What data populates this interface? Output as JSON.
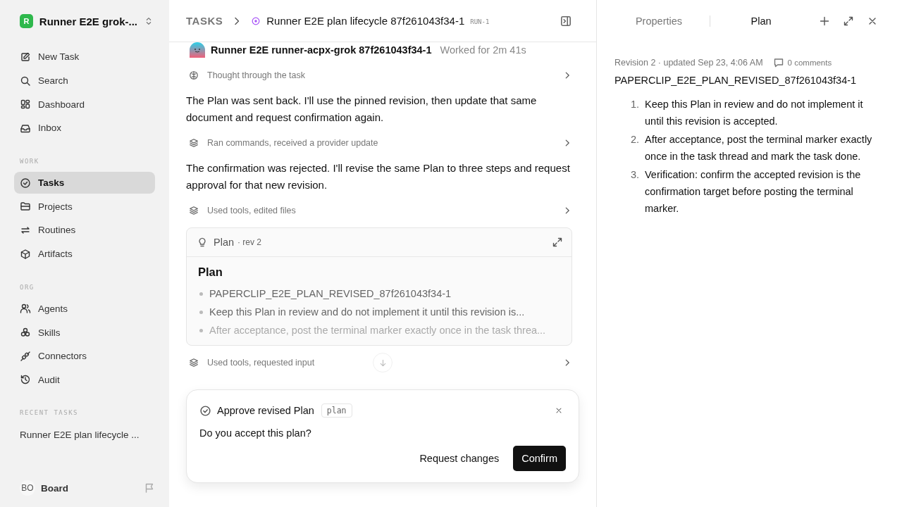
{
  "sidebar": {
    "workspace": {
      "initial": "R",
      "name": "Runner E2E grok-..."
    },
    "items": [
      {
        "label": "New Task",
        "selected": false
      },
      {
        "label": "Search",
        "selected": false
      },
      {
        "label": "Dashboard",
        "selected": false
      },
      {
        "label": "Inbox",
        "selected": false
      }
    ],
    "sections": [
      {
        "title": "WORK",
        "items": [
          {
            "label": "Tasks",
            "selected": true
          },
          {
            "label": "Projects",
            "selected": false
          },
          {
            "label": "Routines",
            "selected": false
          },
          {
            "label": "Artifacts",
            "selected": false
          }
        ]
      },
      {
        "title": "ORG",
        "items": [
          {
            "label": "Agents",
            "selected": false
          },
          {
            "label": "Skills",
            "selected": false
          },
          {
            "label": "Connectors",
            "selected": false
          },
          {
            "label": "Audit",
            "selected": false
          }
        ]
      },
      {
        "title": "RECENT TASKS",
        "items": [
          {
            "label": "Runner E2E plan lifecycle ...",
            "selected": false
          }
        ]
      }
    ],
    "footer": {
      "initials": "BO",
      "name": "Board"
    }
  },
  "header": {
    "breadcrumb": "TASKS",
    "title": "Runner E2E plan lifecycle 87f261043f34-1",
    "run": "RUN-1"
  },
  "feed": {
    "agent": {
      "name": "Runner E2E runner-acpx-grok 87f261043f34-1",
      "worked": "Worked for 2m 41s"
    },
    "entries": [
      {
        "kind": "activity",
        "label": "Thought through the task"
      },
      {
        "kind": "message",
        "text": "The Plan was sent back. I'll use the pinned revision, then update that same document and request confirmation again."
      },
      {
        "kind": "activity",
        "label": "Ran commands, received a provider update"
      },
      {
        "kind": "message",
        "text": "The confirmation was rejected. I'll revise the same Plan to three steps and request approval for that new revision."
      },
      {
        "kind": "activity",
        "label": "Used tools, edited files"
      },
      {
        "kind": "plan",
        "title": "Plan",
        "rev": "· rev 2",
        "heading": "Plan",
        "bullets": [
          "PAPERCLIP_E2E_PLAN_REVISED_87f261043f34-1",
          "Keep this Plan in review and do not implement it until this revision is...",
          "After acceptance, post the terminal marker exactly once in the task threa..."
        ]
      },
      {
        "kind": "activity",
        "label": "Used tools, requested input"
      }
    ]
  },
  "approval": {
    "title": "Approve revised Plan",
    "tag": "plan",
    "question": "Do you accept this plan?",
    "buttons": [
      {
        "label": "Request changes",
        "kind": "secondary"
      },
      {
        "label": "Confirm",
        "kind": "primary"
      }
    ]
  },
  "panel": {
    "tabs": [
      {
        "label": "Properties",
        "selected": false
      },
      {
        "label": "Plan",
        "selected": true
      }
    ],
    "meta": "Revision 2 · updated Sep 23, 4:06 AM",
    "comments": "0 comments",
    "doc_title": "PAPERCLIP_E2E_PLAN_REVISED_87f261043f34-1",
    "steps": [
      {
        "number": "1.",
        "text": "Keep this Plan in review and do not implement it until this revision is accepted."
      },
      {
        "number": "2.",
        "text": "After acceptance, post the terminal marker exactly once in the task thread and mark the task done."
      },
      {
        "number": "3.",
        "text": "Verification: confirm the accepted revision is the confirmation target before posting the terminal marker."
      }
    ]
  }
}
